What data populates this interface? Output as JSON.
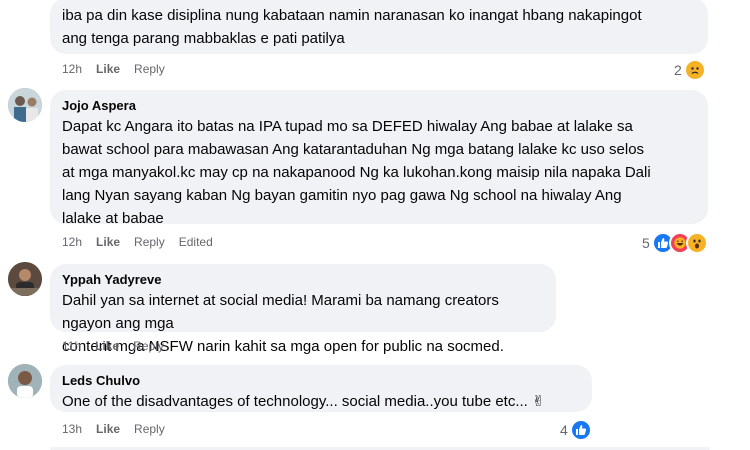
{
  "comments": [
    {
      "author": "",
      "lines": [
        "iba pa din kase disiplina nung kabataan namin naranasan ko inangat hbang nakapingot",
        "ang tenga parang mabbaklas e pati patilya"
      ],
      "time": "12h",
      "like": "Like",
      "reply": "Reply",
      "edited": "",
      "reaction_count": "2",
      "reaction_icons": [
        "sad-icon"
      ]
    },
    {
      "author": "Jojo Aspera",
      "lines": [
        "Dapat kc Angara ito batas na IPA tupad mo sa DEFED hiwalay Ang babae at lalake sa",
        "bawat school para mabawasan Ang katarantaduhan Ng mga batang lalake kc uso selos",
        "at mga manyakol.kc may cp na nakapanood Ng ka lukohan.kong maisip nila napaka Dali",
        "lang Nyan sayang kaban Ng bayan gamitin nyo pag gawa Ng school na hiwalay Ang",
        "lalake at babae"
      ],
      "time": "12h",
      "like": "Like",
      "reply": "Reply",
      "edited": "Edited",
      "reaction_count": "5",
      "reaction_icons": [
        "like-icon",
        "haha-icon",
        "wow-icon"
      ]
    },
    {
      "author": "Yppah Yadyreve",
      "lines": [
        "Dahil yan sa internet at social media! Marami ba namang creators ngayon ang mga",
        "content mga NSFW narin kahit sa mga open for public na socmed."
      ],
      "time": "11h",
      "like": "Like",
      "reply": "Reply",
      "edited": "",
      "reaction_count": "",
      "reaction_icons": []
    },
    {
      "author": "Leds Chulvo",
      "lines": [
        "One of the disadvantages of technology... social media..you tube etc... ✌"
      ],
      "time": "13h",
      "like": "Like",
      "reply": "Reply",
      "edited": "",
      "reaction_count": "4",
      "reaction_icons": [
        "like-icon"
      ]
    }
  ]
}
